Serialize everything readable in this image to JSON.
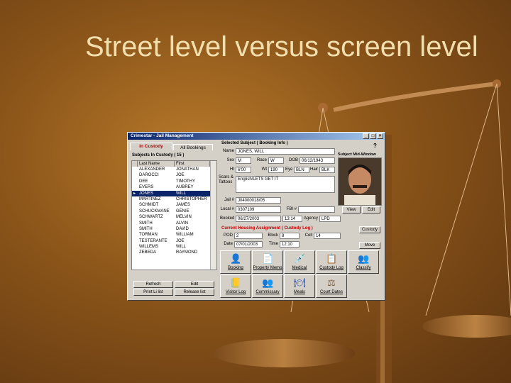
{
  "slide": {
    "title": "Street level versus screen level"
  },
  "window": {
    "title": "Crimestar - Jail Management",
    "controls": [
      "_",
      "□",
      "×"
    ]
  },
  "tabs": {
    "in_custody": "In Custody",
    "all_bookings": "All Bookings"
  },
  "list": {
    "header": "Subjects In Custody ( 15 )",
    "columns": [
      "Last Name",
      "First"
    ],
    "rows": [
      [
        "ALEXANDER",
        "JONATHAN"
      ],
      [
        "DAROCCI",
        "JOE"
      ],
      [
        "DEE",
        "TIMOTHY"
      ],
      [
        "EVERS",
        "AUBREY"
      ],
      [
        "JONES",
        "WILL"
      ],
      [
        "MARTINEZ",
        "CHRISTOPHER"
      ],
      [
        "SCHMIDT",
        "JAMES"
      ],
      [
        "SCHUCKMANE",
        "GENIE"
      ],
      [
        "SCHWARTZ",
        "MELVIN"
      ],
      [
        "SMITH",
        "ALVIN"
      ],
      [
        "SMITH",
        "DAVID"
      ],
      [
        "TORMAN",
        "WILLIAM"
      ],
      [
        "TESTERANTE",
        "JOE"
      ],
      [
        "WILLEMS",
        "WILL"
      ],
      [
        "ZEBEDA",
        "RAYMOND"
      ]
    ],
    "selected_index": 4,
    "refresh": "Refresh",
    "edit": "Edit",
    "print_list": "Print Li list",
    "release_list": "Release list"
  },
  "subject": {
    "section": "Selected Subject ( Booking Info )",
    "name_label": "Name",
    "name": "JONES, WILL",
    "sex_label": "Sex",
    "sex": "M",
    "race_label": "Race",
    "race": "W",
    "dob_label": "DOB",
    "dob": "06/12/1943",
    "ht_label": "Ht",
    "ht": "6'00",
    "wt_label": "Wt",
    "wt": "190",
    "eye_label": "Eye",
    "eye": "BLN",
    "hair_label": "Hair",
    "hair": "BLK",
    "scars_label": "Scars & Tattoos",
    "scars": "English/LETS GET IT",
    "jail_label": "Jail #",
    "jail": "J04000018/05",
    "local_label": "Local #",
    "local": "0307109",
    "fbi_label": "FBI #",
    "fbi": "",
    "booked_label": "Booked",
    "booked": "06/27/2003",
    "booked_time": "13:14",
    "agency_label": "Agency",
    "agency": "LPD",
    "photo_header": "Subject Mid-Window",
    "view_btn": "View",
    "edit_btn": "Edit"
  },
  "housing": {
    "section": "Current Housing Assignment ( Custody Log )",
    "pod_label": "POD",
    "pod": "2",
    "block_label": "Block",
    "block": "8",
    "cell_label": "Cell",
    "cell": "14",
    "date_label": "Date",
    "date": "07/01/2003",
    "time_label": "Time",
    "time": "12:10",
    "custody_btn": "Custody",
    "move_btn": "Move"
  },
  "actions": [
    {
      "label": "Booking",
      "icon": "booking-icon",
      "glyph": "👤"
    },
    {
      "label": "Property Memo",
      "icon": "property-icon",
      "glyph": "📄"
    },
    {
      "label": "Medical",
      "icon": "medical-icon",
      "glyph": "💉"
    },
    {
      "label": "Custody Log",
      "icon": "custody-log-icon",
      "glyph": "📋"
    },
    {
      "label": "Classify",
      "icon": "classify-icon",
      "glyph": "👥"
    },
    {
      "label": "Visitor Log",
      "icon": "visitor-log-icon",
      "glyph": "📒"
    },
    {
      "label": "Commissary",
      "icon": "commissary-icon",
      "glyph": "👥"
    },
    {
      "label": "Meals",
      "icon": "meals-icon",
      "glyph": "🍽"
    },
    {
      "label": "Court Dates",
      "icon": "court-dates-icon",
      "glyph": "⚖"
    }
  ]
}
